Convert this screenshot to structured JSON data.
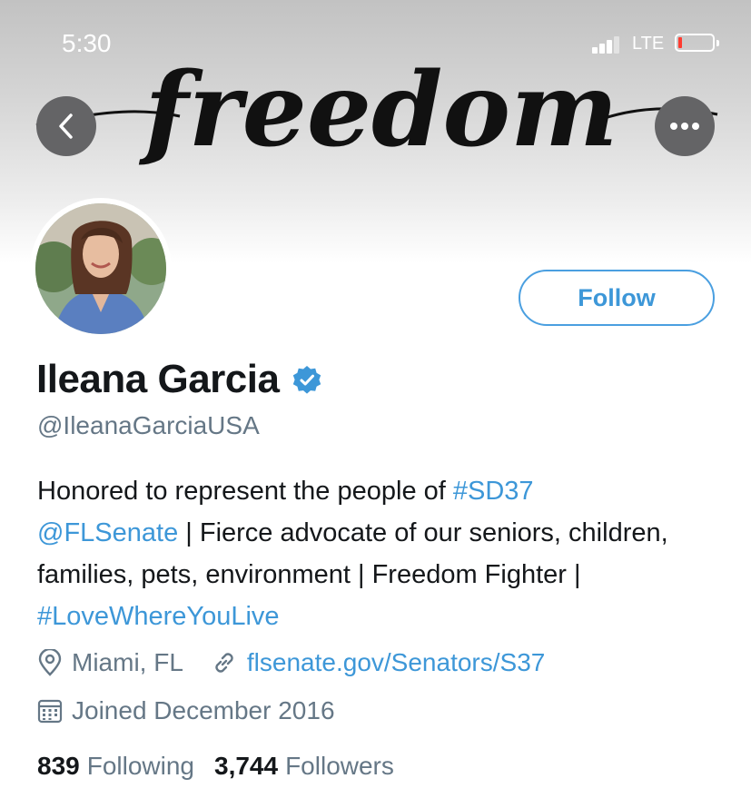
{
  "status_bar": {
    "time": "5:30",
    "network": "LTE",
    "battery_color": "#ff3b30"
  },
  "banner": {
    "script_text": "freedom"
  },
  "nav": {
    "back_icon": "chevron-left-icon",
    "more_icon": "more-horizontal-icon"
  },
  "profile": {
    "name": "Ileana Garcia",
    "verified": true,
    "handle": "@IleanaGarciaUSA",
    "follow_label": "Follow",
    "bio": {
      "t1": "Honored to represent the people of ",
      "hashtag1": "#SD37",
      "mention": "@FLSenate",
      "t2": " | Fierce advocate of our seniors, children, families, pets, environment | Freedom Fighter | ",
      "hashtag2": "#LoveWhereYouLive"
    },
    "location": "Miami, FL",
    "website": "flsenate.gov/Senators/S37",
    "joined": "Joined December 2016",
    "following_count": "839",
    "following_label": "Following",
    "followers_count": "3,744",
    "followers_label": "Followers"
  },
  "colors": {
    "accent": "#3d97d8",
    "secondary_text": "#657786",
    "verified_badge": "#3d97d8"
  }
}
